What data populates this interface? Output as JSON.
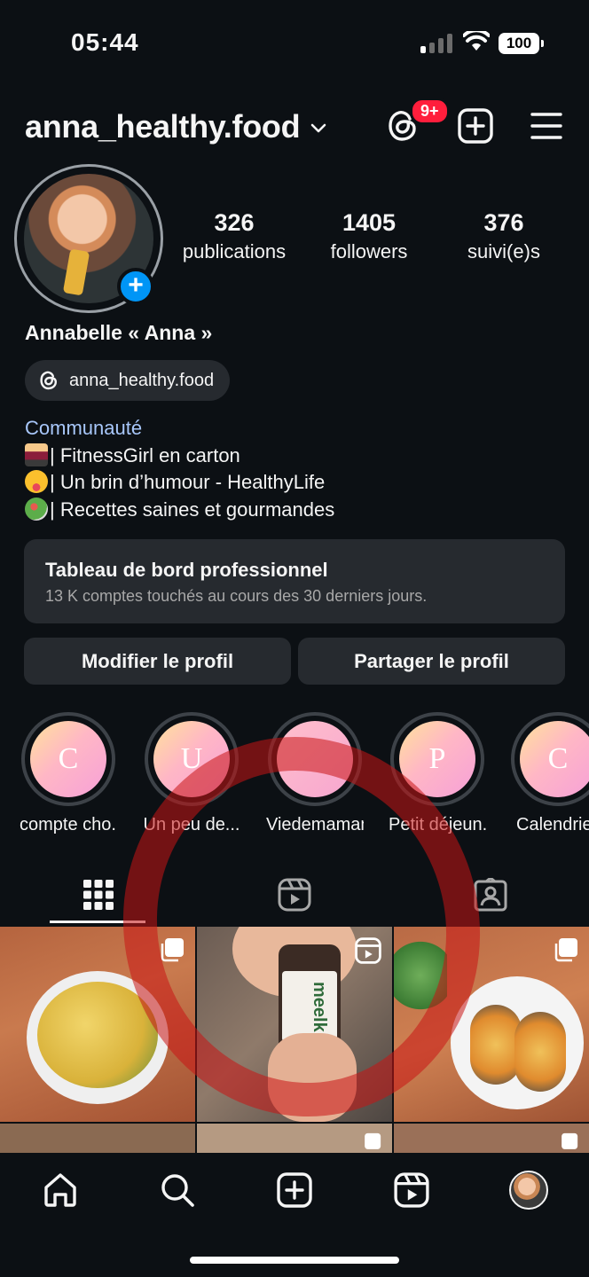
{
  "status_bar": {
    "time": "05:44",
    "battery": "100"
  },
  "header": {
    "username": "anna_healthy.food",
    "threads_badge": "9+"
  },
  "profile": {
    "stats": [
      {
        "value": "326",
        "label": "publications"
      },
      {
        "value": "1405",
        "label": "followers"
      },
      {
        "value": "376",
        "label": "suivi(e)s"
      }
    ],
    "full_name": "Annabelle « Anna »",
    "threads_handle": "anna_healthy.food",
    "category": "Communauté",
    "bio_lines": [
      {
        "emoji": "weightlifter",
        "text": "| FitnessGirl en carton"
      },
      {
        "emoji": "zany-face",
        "text": "| Un brin d’humour - HealthyLife"
      },
      {
        "emoji": "salad",
        "text": "| Recettes saines et gourmandes"
      }
    ]
  },
  "dashboard": {
    "title": "Tableau de bord professionnel",
    "subtitle": "13 K comptes touchés au cours des 30 derniers jours."
  },
  "buttons": {
    "edit": "Modifier le profil",
    "share": "Partager le profil"
  },
  "highlights": [
    {
      "letter": "C",
      "label": "compte cho..."
    },
    {
      "letter": "U",
      "label": "Un peu de..."
    },
    {
      "letter": "",
      "label": "Viedemaman"
    },
    {
      "letter": "P",
      "label": "Petit déjeun..."
    },
    {
      "letter": "C",
      "label": "Calendrier"
    }
  ],
  "grid_posts": [
    {
      "kind": "carousel",
      "desc": "pasta-bowl"
    },
    {
      "kind": "reel",
      "desc": "meelk-jar",
      "jar_label": "meelk"
    },
    {
      "kind": "carousel",
      "desc": "toasts-plate"
    }
  ],
  "colors": {
    "accent": "#0095f6",
    "badge": "#ff1e3c",
    "link": "#a8c7fa",
    "background": "#0c1014",
    "card": "#262a2f"
  }
}
